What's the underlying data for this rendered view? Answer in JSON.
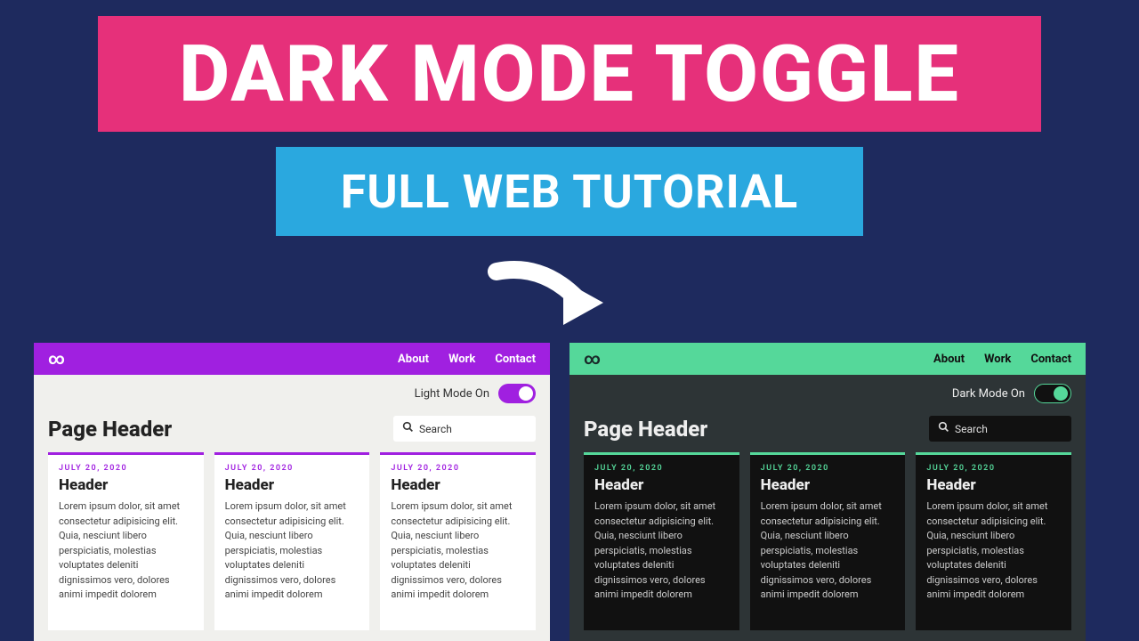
{
  "banner": {
    "title": "DARK MODE TOGGLE",
    "subtitle": "FULL WEB TUTORIAL"
  },
  "nav": {
    "links": [
      "About",
      "Work",
      "Contact"
    ]
  },
  "light": {
    "mode_label": "Light Mode On",
    "page_header": "Page Header",
    "search_placeholder": "Search"
  },
  "dark": {
    "mode_label": "Dark Mode On",
    "page_header": "Page Header",
    "search_placeholder": "Search"
  },
  "card": {
    "date": "JULY 20, 2020",
    "title": "Header",
    "body": "Lorem ipsum dolor, sit amet consectetur adipisicing elit. Quia, nesciunt libero perspiciatis, molestias voluptates deleniti dignissimos vero, dolores animi impedit dolorem"
  }
}
